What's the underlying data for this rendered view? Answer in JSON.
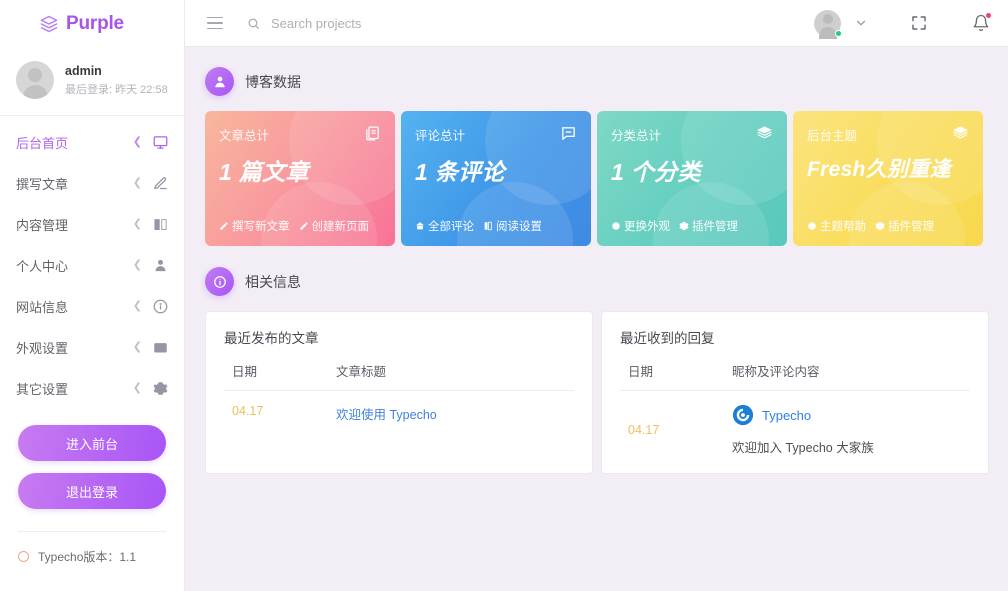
{
  "brand": {
    "name": "Purple",
    "icon": "layers-icon"
  },
  "user": {
    "name": "admin",
    "meta": "最后登录: 昨天 22:58"
  },
  "sidebar": {
    "items": [
      {
        "label": "后台首页",
        "icon": "monitor-icon",
        "active": true
      },
      {
        "label": "撰写文章",
        "icon": "pencil-icon",
        "active": false
      },
      {
        "label": "内容管理",
        "icon": "book-icon",
        "active": false
      },
      {
        "label": "个人中心",
        "icon": "user-icon",
        "active": false
      },
      {
        "label": "网站信息",
        "icon": "info-icon",
        "active": false
      },
      {
        "label": "外观设置",
        "icon": "image-icon",
        "active": false
      },
      {
        "label": "其它设置",
        "icon": "gear-icon",
        "active": false
      }
    ],
    "buttons": {
      "front": "进入前台",
      "logout": "退出登录"
    },
    "version": "Typecho版本：1.1"
  },
  "topbar": {
    "menu_icon": "hamburger-icon",
    "search_placeholder": "Search projects",
    "search_value": "",
    "fullscreen_icon": "fullscreen-icon",
    "bell_icon": "bell-icon"
  },
  "sections": {
    "stats": {
      "title": "博客数据",
      "icon": "user-badge-icon"
    },
    "info": {
      "title": "相关信息",
      "icon": "info-badge-icon"
    }
  },
  "cards": [
    {
      "label": "文章总计",
      "value": "1 篇文章",
      "icon": "document-icon",
      "color": "#f87296",
      "links": [
        {
          "text": "撰写新文章",
          "icon": "pencil-icon"
        },
        {
          "text": "创建新页面",
          "icon": "pencil-icon"
        }
      ]
    },
    {
      "label": "评论总计",
      "value": "1 条评论",
      "icon": "comment-icon",
      "color": "#3f8ae4",
      "links": [
        {
          "text": "全部评论",
          "icon": "tag-icon"
        },
        {
          "text": "阅读设置",
          "icon": "book-icon"
        }
      ]
    },
    {
      "label": "分类总计",
      "value": "1 个分类",
      "icon": "layers-icon",
      "color": "#5ac8bd",
      "links": [
        {
          "text": "更换外观",
          "icon": "dot-icon"
        },
        {
          "text": "插件管理",
          "icon": "gear-icon"
        }
      ]
    },
    {
      "label": "后台主题",
      "value": "Fresh久别重逢",
      "icon": "layers-icon",
      "color": "#f8d84c",
      "links": [
        {
          "text": "主题帮助",
          "icon": "dot-icon"
        },
        {
          "text": "插件管理",
          "icon": "gear-icon"
        }
      ]
    }
  ],
  "panels": {
    "recent_posts": {
      "title": "最近发布的文章",
      "columns": [
        "日期",
        "文章标题"
      ],
      "rows": [
        {
          "date": "04.17",
          "title": "欢迎使用 Typecho"
        }
      ]
    },
    "recent_replies": {
      "title": "最近收到的回复",
      "columns": [
        "日期",
        "昵称及评论内容"
      ],
      "rows": [
        {
          "date": "04.17",
          "author": "Typecho",
          "content": "欢迎加入 Typecho 大家族",
          "avatar": "typecho-logo-icon"
        }
      ]
    }
  }
}
